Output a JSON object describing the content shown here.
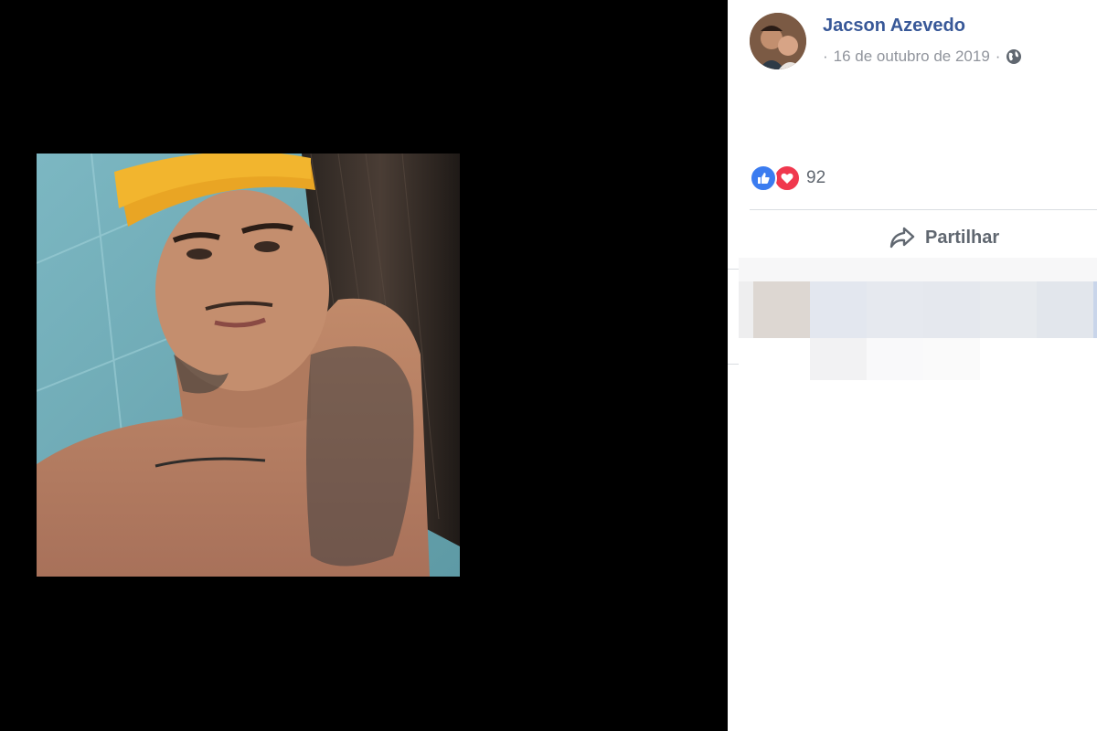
{
  "post": {
    "author": "Jacson Azevedo",
    "date": "16 de outubro de 2019",
    "separator": "·",
    "privacy_icon": "globe-icon"
  },
  "reactions": {
    "types": [
      "like-icon",
      "love-icon"
    ],
    "count": "92"
  },
  "actions": {
    "share_label": "Partilhar",
    "share_icon": "share-arrow-icon"
  },
  "colors": {
    "author_link": "#385898",
    "like": "#3b7cf0",
    "love": "#f0384e",
    "muted_text": "#90949c",
    "viewer_bg": "#000000"
  }
}
